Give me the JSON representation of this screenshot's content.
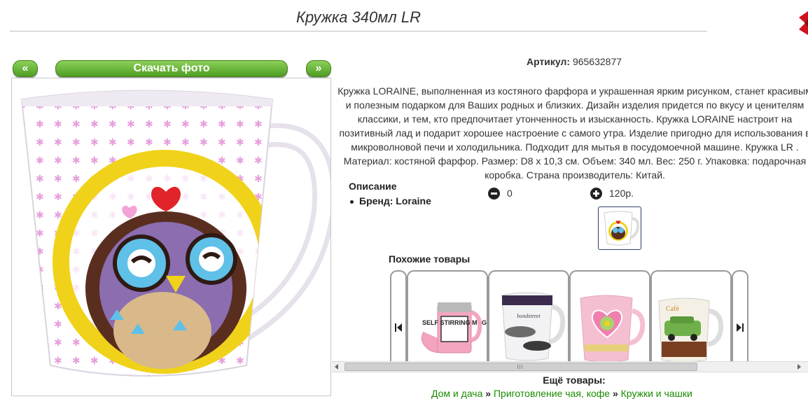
{
  "product": {
    "title": "Кружка 340мл LR",
    "sku_label": "Артикул:",
    "sku_value": "965632877",
    "description": "Кружка LORAINE, выполненная из костяного фарфора и украшенная ярким рисунком, станет красивым и полезным подарком для Ваших родных и близких. Дизайн изделия придется по вкусу и ценителям классики, и тем, кто предпочитает утонченность и изысканность. Кружка LORAINE настроит на позитивный лад и подарит хорошее настроение с самого утра. Изделие пригодно для использования в микроволновой печи и холодильника. Подходит для мытья в посудомоечной машине. Кружка LR . Материал: костяной фарфор. Размер: D8 х 10,3 см. Объем: 340 мл. Вес: 250 г. Упаковка: подарочная коробка. Страна производитель: Китай.",
    "desc_heading": "Описание",
    "brand": "Бренд: Loraine",
    "quantity": "0",
    "price": "120р."
  },
  "photo_nav": {
    "prev_label": "«",
    "download_label": "Скачать фото",
    "next_label": "»"
  },
  "similar": {
    "heading": "Похожие товары",
    "items": [
      {
        "name": "self-stirring-mug",
        "print_text": "SELF STIRRING MUG"
      },
      {
        "name": "cars-mug",
        "print_text": "bondstreet"
      },
      {
        "name": "heart-mug",
        "print_text": ""
      },
      {
        "name": "retro-car-mug",
        "print_text": "Café"
      }
    ]
  },
  "more": {
    "heading": "Ещё товары:",
    "breadcrumbs": [
      "Дом и дача",
      "Приготовление чая, кофе",
      "Кружки и чашки"
    ],
    "separator": "»"
  },
  "colors": {
    "button_green": "#5aa82a",
    "link_green": "#1a8c00",
    "accent_red": "#d0111d"
  }
}
